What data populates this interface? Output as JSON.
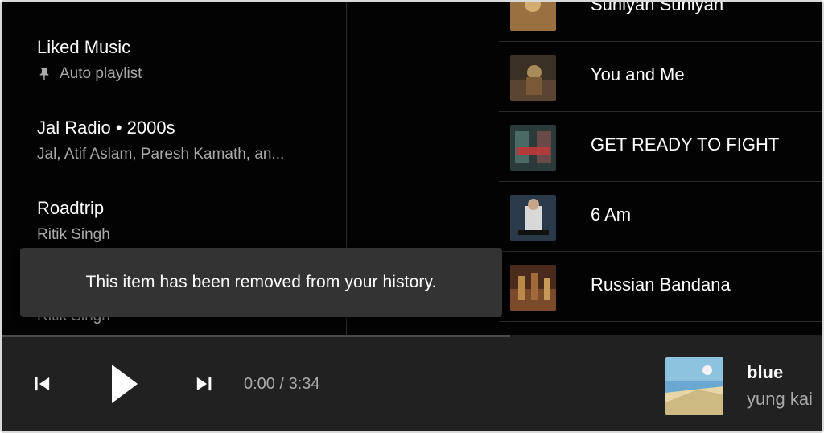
{
  "library": {
    "items": [
      {
        "title": "Liked Music",
        "subtitle": "Auto playlist",
        "pinned": true
      },
      {
        "title": "Jal Radio • 2000s",
        "subtitle": "Jal, Atif Aslam, Paresh Kamath, an..."
      },
      {
        "title": "Roadtrip",
        "subtitle": "Ritik Singh"
      }
    ],
    "partial_subtitle": "Ritik Singh"
  },
  "songs": [
    {
      "title": "Suniyan Suniyan",
      "thumb_colors": [
        "#6b4a2a",
        "#c9a46a"
      ]
    },
    {
      "title": "You and Me",
      "thumb_colors": [
        "#3a3024",
        "#a98a5a"
      ]
    },
    {
      "title": "GET READY TO FIGHT",
      "thumb_colors": [
        "#2b3b3a",
        "#b33a3a"
      ]
    },
    {
      "title": "6 Am",
      "thumb_colors": [
        "#2a3a4a",
        "#d8d8d8"
      ]
    },
    {
      "title": "Russian Bandana",
      "thumb_colors": [
        "#4a2a1a",
        "#b98a4a"
      ]
    }
  ],
  "toast": {
    "message": "This item has been removed from your history."
  },
  "player": {
    "time": "0:00 / 3:34",
    "progress": 0,
    "prev_icon": "skip-previous-icon",
    "play_icon": "play-icon",
    "next_icon": "skip-next-icon",
    "now_playing": {
      "title": "blue",
      "artist": "yung kai"
    }
  },
  "colors": {
    "background": "#030303",
    "player_bar": "#212121",
    "toast": "#333333",
    "secondary_text": "#aaaaaa"
  }
}
